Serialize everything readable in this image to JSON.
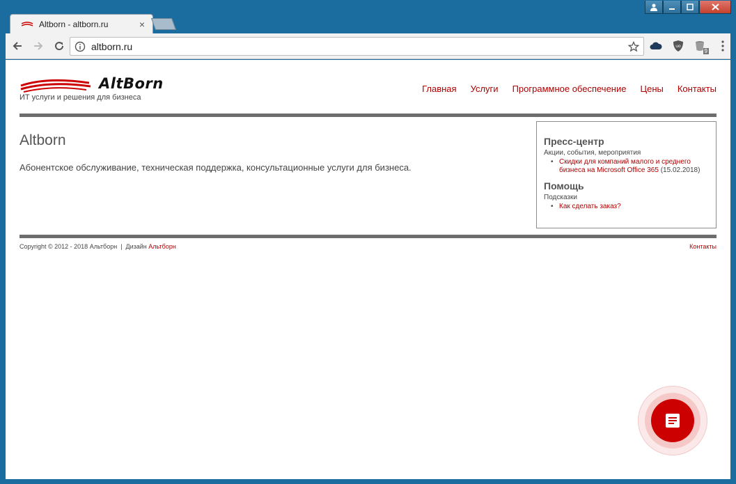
{
  "browser": {
    "tab_title": "Altborn - altborn.ru",
    "tab_close": "×",
    "url": "altborn.ru",
    "extension_badge": "9"
  },
  "site": {
    "logo_text": "AltBorn",
    "tagline": "ИТ услуги и решения для бизнеса",
    "nav": [
      {
        "label": "Главная"
      },
      {
        "label": "Услуги"
      },
      {
        "label": "Программное обеспечение"
      },
      {
        "label": "Цены"
      },
      {
        "label": "Контакты"
      }
    ],
    "main": {
      "title": "Altborn",
      "lead": "Абонентское обслуживание, техническая поддержка, консультационные услуги для бизнеса."
    },
    "sidebar": {
      "press": {
        "heading": "Пресс-центр",
        "sub": "Акции, события, мероприятия",
        "item_link": "Скидки для компаний малого и среднего бизнеса на Microsoft Office 365",
        "item_date": " (15.02.2018)"
      },
      "help": {
        "heading": "Помощь",
        "sub": "Подсказки",
        "item_link": "Как сделать заказ?"
      }
    },
    "footer": {
      "copyright": "Copyright © 2012 - 2018 Альтборн  |  Дизайн ",
      "design_link": "Альтборн",
      "contacts": "Контакты"
    }
  },
  "colors": {
    "accent": "#b00000",
    "fab": "#cc0000",
    "rule": "#6d6d6d"
  },
  "icons": {
    "back": "back-arrow-icon",
    "forward": "forward-arrow-icon",
    "reload": "reload-icon",
    "info": "info-icon",
    "star": "star-icon",
    "menu": "kebab-menu-icon",
    "fab": "document-icon"
  }
}
